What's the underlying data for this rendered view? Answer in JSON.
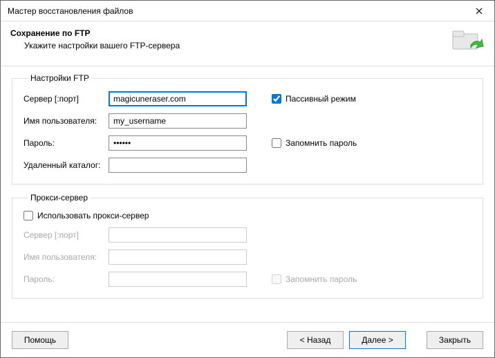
{
  "window": {
    "title": "Мастер восстановления файлов"
  },
  "header": {
    "title": "Сохранение по FTP",
    "subtitle": "Укажите настройки вашего FTP-сервера"
  },
  "ftp": {
    "legend": "Настройки FTP",
    "server_label": "Сервер [:порт]",
    "server_value": "magicuneraser.com",
    "user_label": "Имя пользователя:",
    "user_value": "my_username",
    "pass_label": "Пароль:",
    "pass_value": "••••••",
    "dir_label": "Удаленный каталог:",
    "dir_value": "",
    "passive_label": "Пассивный режим",
    "remember_label": "Запомнить пароль"
  },
  "proxy": {
    "legend": "Прокси-сервер",
    "use_label": "Использовать прокси-сервер",
    "server_label": "Сервер [:порт]",
    "user_label": "Имя пользователя:",
    "pass_label": "Пароль:",
    "remember_label": "Запомнить пароль"
  },
  "buttons": {
    "help": "Помощь",
    "back": "< Назад",
    "next": "Далее >",
    "close": "Закрыть"
  }
}
